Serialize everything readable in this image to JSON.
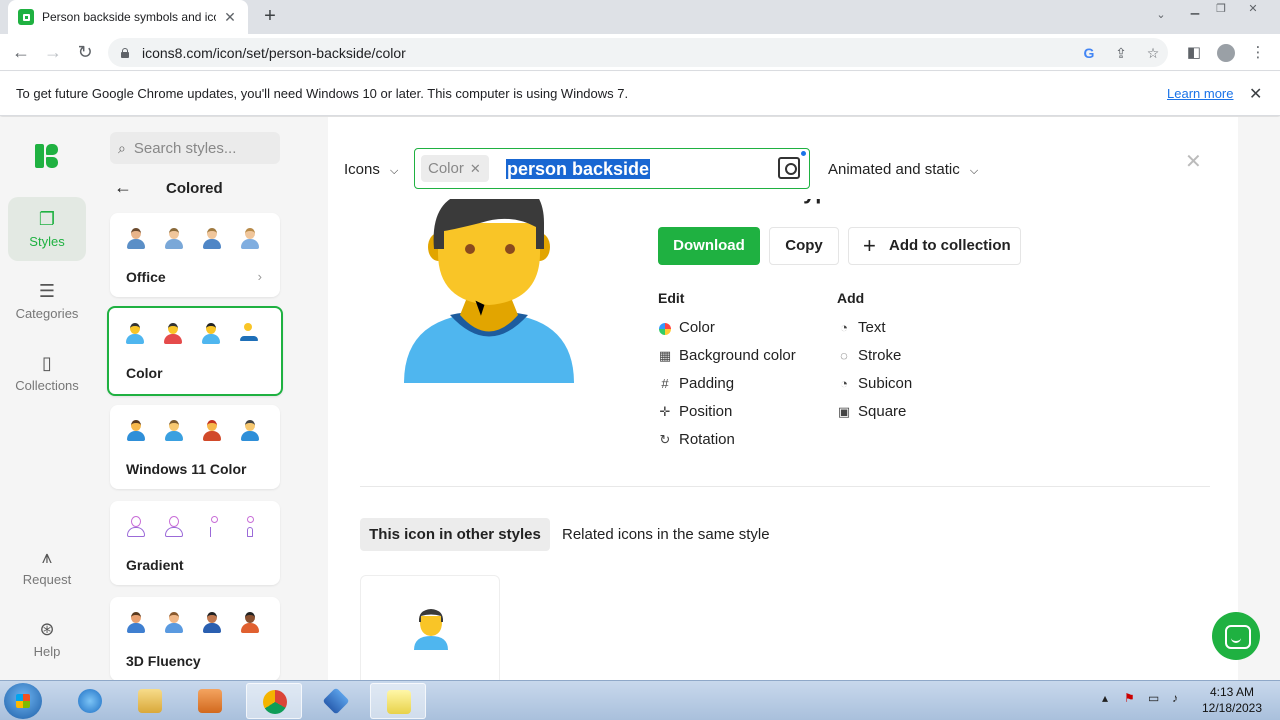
{
  "browser": {
    "tab_title": "Person backside symbols and ico",
    "tab_close": "✕",
    "new_tab": "+",
    "url": "icons8.com/icon/set/person-backside/color",
    "infobar_text": "To get future Google Chrome updates, you'll need Windows 10 or later. This computer is using Windows 7.",
    "infobar_link": "Learn more",
    "infobar_close": "✕"
  },
  "rail": {
    "items": [
      {
        "label": "Styles",
        "icon": "styles-icon"
      },
      {
        "label": "Categories",
        "icon": "list-icon"
      },
      {
        "label": "Collections",
        "icon": "bookmark-icon"
      },
      {
        "label": "Request",
        "icon": "request-icon"
      },
      {
        "label": "Help",
        "icon": "lifebuoy-icon"
      }
    ]
  },
  "styles_panel": {
    "search_placeholder": "Search styles...",
    "back": "←",
    "title": "Colored",
    "cards": [
      {
        "name": "Office"
      },
      {
        "name": "Color"
      },
      {
        "name": "Windows 11 Color"
      },
      {
        "name": "Gradient"
      },
      {
        "name": "3D Fluency"
      }
    ]
  },
  "search": {
    "type_dropdown": "Icons",
    "chip": "Color",
    "query": "person backside",
    "anim_dropdown": "Animated and static"
  },
  "detail": {
    "title": "Person Skin Type 7",
    "download": "Download",
    "copy": "Copy",
    "add_collection": "Add to collection",
    "edit_heading": "Edit",
    "add_heading": "Add",
    "edit_options": [
      "Color",
      "Background color",
      "Padding",
      "Position",
      "Rotation"
    ],
    "add_options": [
      "Text",
      "Stroke",
      "Subicon",
      "Square"
    ]
  },
  "tabs": {
    "active": "This icon in other styles",
    "other": "Related icons in the same style"
  },
  "taskbar": {
    "time": "4:13 AM",
    "date": "12/18/2023"
  },
  "colors": {
    "accent": "#1fb141",
    "skin": "#f9c527",
    "shirt": "#4fb6ef",
    "hair": "#3a3a3a"
  }
}
